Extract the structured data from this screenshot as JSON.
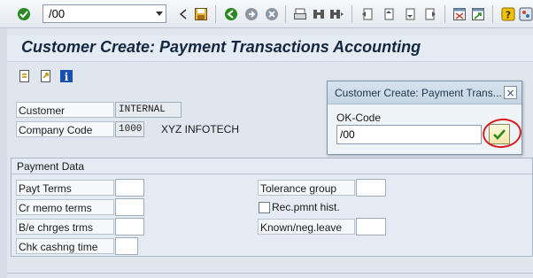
{
  "toolbar": {
    "command_field": "/00",
    "icons": [
      "enter-check-icon",
      "command-dropdown-icon",
      "back-triangle-icon",
      "save-icon",
      "back-green-icon",
      "exit-icon",
      "cancel-icon",
      "print-icon",
      "find-icon",
      "find-next-icon",
      "first-page-icon",
      "previous-page-icon",
      "next-page-icon",
      "last-page-icon",
      "new-session-icon",
      "shortcut-icon",
      "help-icon",
      "customize-layout-icon"
    ]
  },
  "header": {
    "title": "Customer Create: Payment Transactions Accounting"
  },
  "app_toolbar": {
    "icons": [
      "previous-screen-icon",
      "next-screen-icon",
      "info-icon"
    ]
  },
  "fields": {
    "customer_label": "Customer",
    "customer_value": "INTERNAL",
    "company_code_label": "Company Code",
    "company_code_value": "1000",
    "company_name": "XYZ INFOTECH"
  },
  "payment_data": {
    "title": "Payment Data",
    "payt_terms_label": "Payt Terms",
    "cr_memo_terms_label": "Cr memo terms",
    "be_charges_label": "B/e chrges trms",
    "chk_cashng_label": "Chk cashng time",
    "tolerance_group_label": "Tolerance group",
    "rec_pmnt_hist_label": "Rec.pmnt hist.",
    "known_neg_leave_label": "Known/neg.leave"
  },
  "dialog": {
    "title": "Customer Create: Payment Trans...",
    "close_glyph": "×",
    "ok_code_label": "OK-Code",
    "ok_code_value": "/00"
  },
  "colors": {
    "accent_green": "#2a8a1f",
    "highlight_red": "#d81c1c"
  }
}
